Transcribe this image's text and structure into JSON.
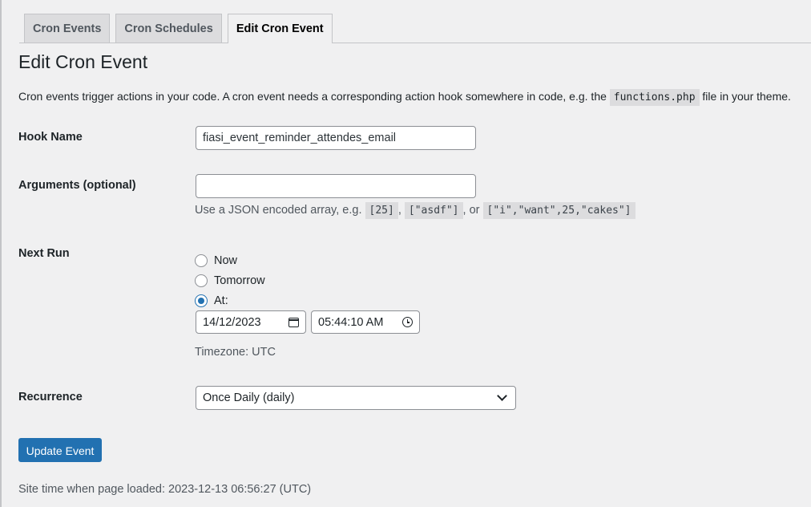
{
  "tabs": [
    {
      "label": "Cron Events",
      "active": false
    },
    {
      "label": "Cron Schedules",
      "active": false
    },
    {
      "label": "Edit Cron Event",
      "active": true
    }
  ],
  "page_title": "Edit Cron Event",
  "intro": {
    "before": "Cron events trigger actions in your code. A cron event needs a corresponding action hook somewhere in code, e.g. the ",
    "code": "functions.php",
    "after": " file in your theme."
  },
  "hook_name": {
    "label": "Hook Name",
    "value": "fiasi_event_reminder_attendes_email"
  },
  "arguments": {
    "label": "Arguments (optional)",
    "value": "",
    "hint_prefix": "Use a JSON encoded array, e.g. ",
    "example1": "[25]",
    "sep1": ", ",
    "example2": "[\"asdf\"]",
    "sep2": ", or ",
    "example3": "[\"i\",\"want\",25,\"cakes\"]"
  },
  "next_run": {
    "label": "Next Run",
    "options": [
      {
        "label": "Now",
        "checked": false
      },
      {
        "label": "Tomorrow",
        "checked": false
      },
      {
        "label": "At:",
        "checked": true
      }
    ],
    "date": "14/12/2023",
    "time": "05:44:10 AM",
    "timezone": "Timezone: UTC"
  },
  "recurrence": {
    "label": "Recurrence",
    "selected": "Once Daily (daily)"
  },
  "submit_label": "Update Event",
  "site_time": "Site time when page loaded: 2023-12-13 06:56:27 (UTC)",
  "colors": {
    "accent": "#2271b1",
    "background": "#f0f0f1"
  }
}
